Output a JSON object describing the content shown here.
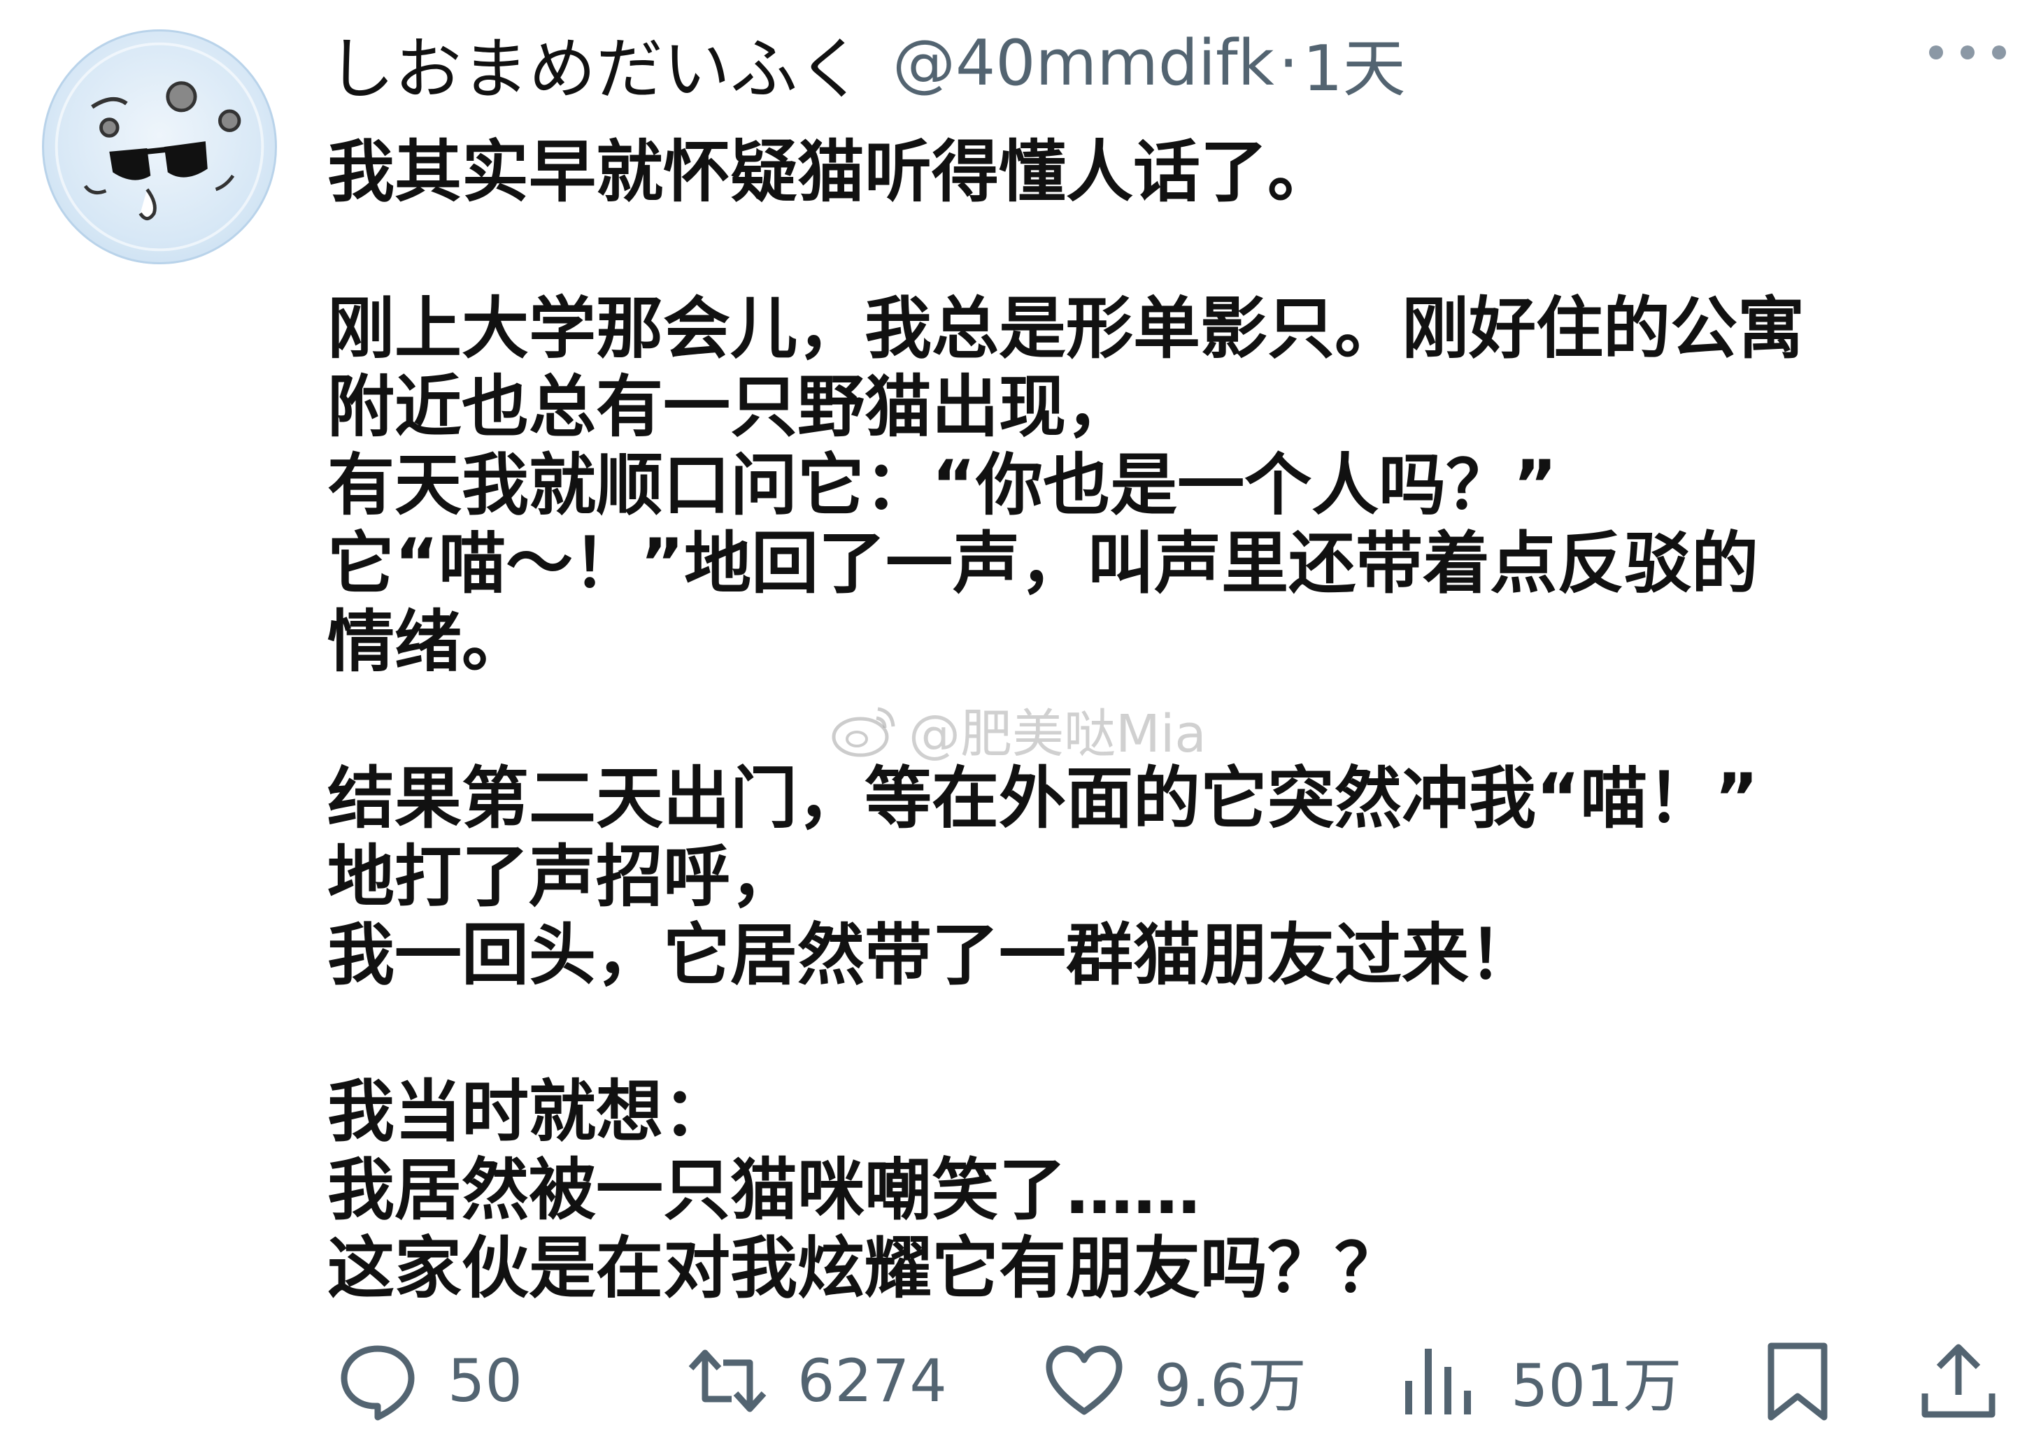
{
  "user": {
    "display_name": "しおまめだいふく",
    "handle": "@40mmdifk",
    "separator": "·",
    "time": "1天"
  },
  "icons": {
    "avatar": "cartoon-face-sunglasses-avatar",
    "more": "more-dots-icon",
    "reply": "reply-bubble-icon",
    "retweet": "retweet-icon",
    "like": "heart-icon",
    "views": "bar-chart-icon",
    "bookmark": "bookmark-icon",
    "share": "share-upload-icon"
  },
  "post": {
    "paragraphs": [
      [
        "我其实早就怀疑猫听得懂人话了。"
      ],
      [
        "刚上大学那会儿，我总是形单影只。刚好住的公寓",
        "附近也总有一只野猫出现，",
        "有天我就顺口问它：“你也是一个人吗？”",
        "它“喵～！”地回了一声，叫声里还带着点反驳的",
        "情绪。"
      ],
      [
        "结果第二天出门，等在外面的它突然冲我“喵！”",
        "地打了声招呼，",
        "我一回头，它居然带了一群猫朋友过来！"
      ],
      [
        "我当时就想：",
        "我居然被一只猫咪嘲笑了……",
        "这家伙是在对我炫耀它有朋友吗？？"
      ]
    ]
  },
  "watermark": {
    "text": "@肥美哒Mia",
    "icon": "weibo-logo-icon"
  },
  "stats": {
    "replies": "50",
    "retweets": "6274",
    "likes": "9.6万",
    "views": "501万"
  },
  "colors": {
    "text": "#111111",
    "secondary": "#536471",
    "watermark": "#aaaaaa"
  }
}
